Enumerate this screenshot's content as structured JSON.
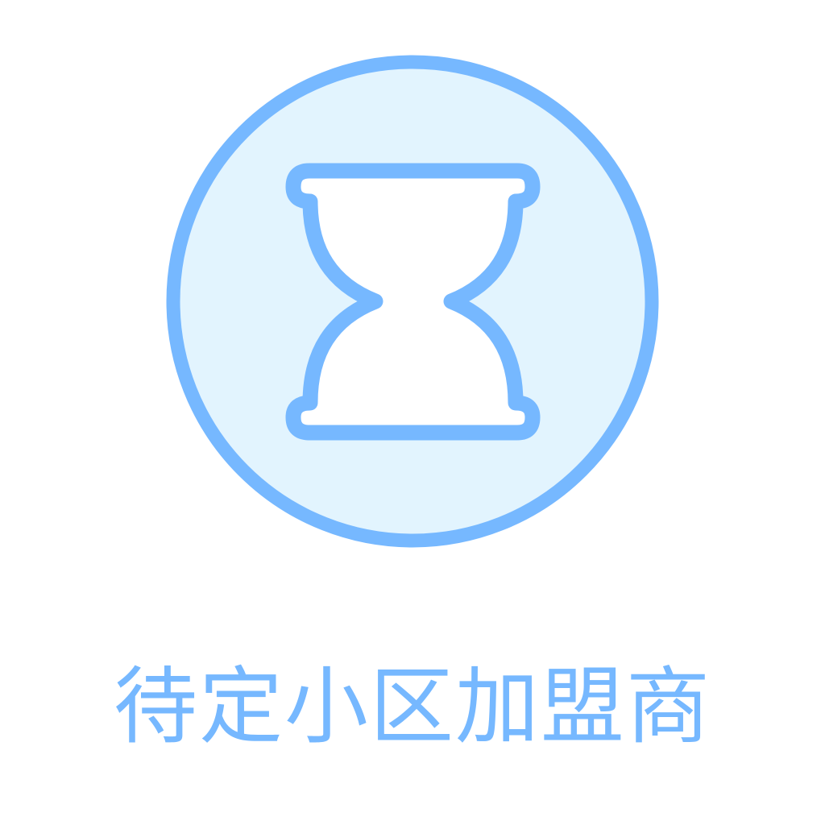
{
  "status": {
    "icon": "hourglass-icon",
    "label": "待定小区加盟商"
  },
  "colors": {
    "accent": "#76b8ff",
    "icon_fill": "#e2f4fe",
    "background": "#ffffff"
  }
}
